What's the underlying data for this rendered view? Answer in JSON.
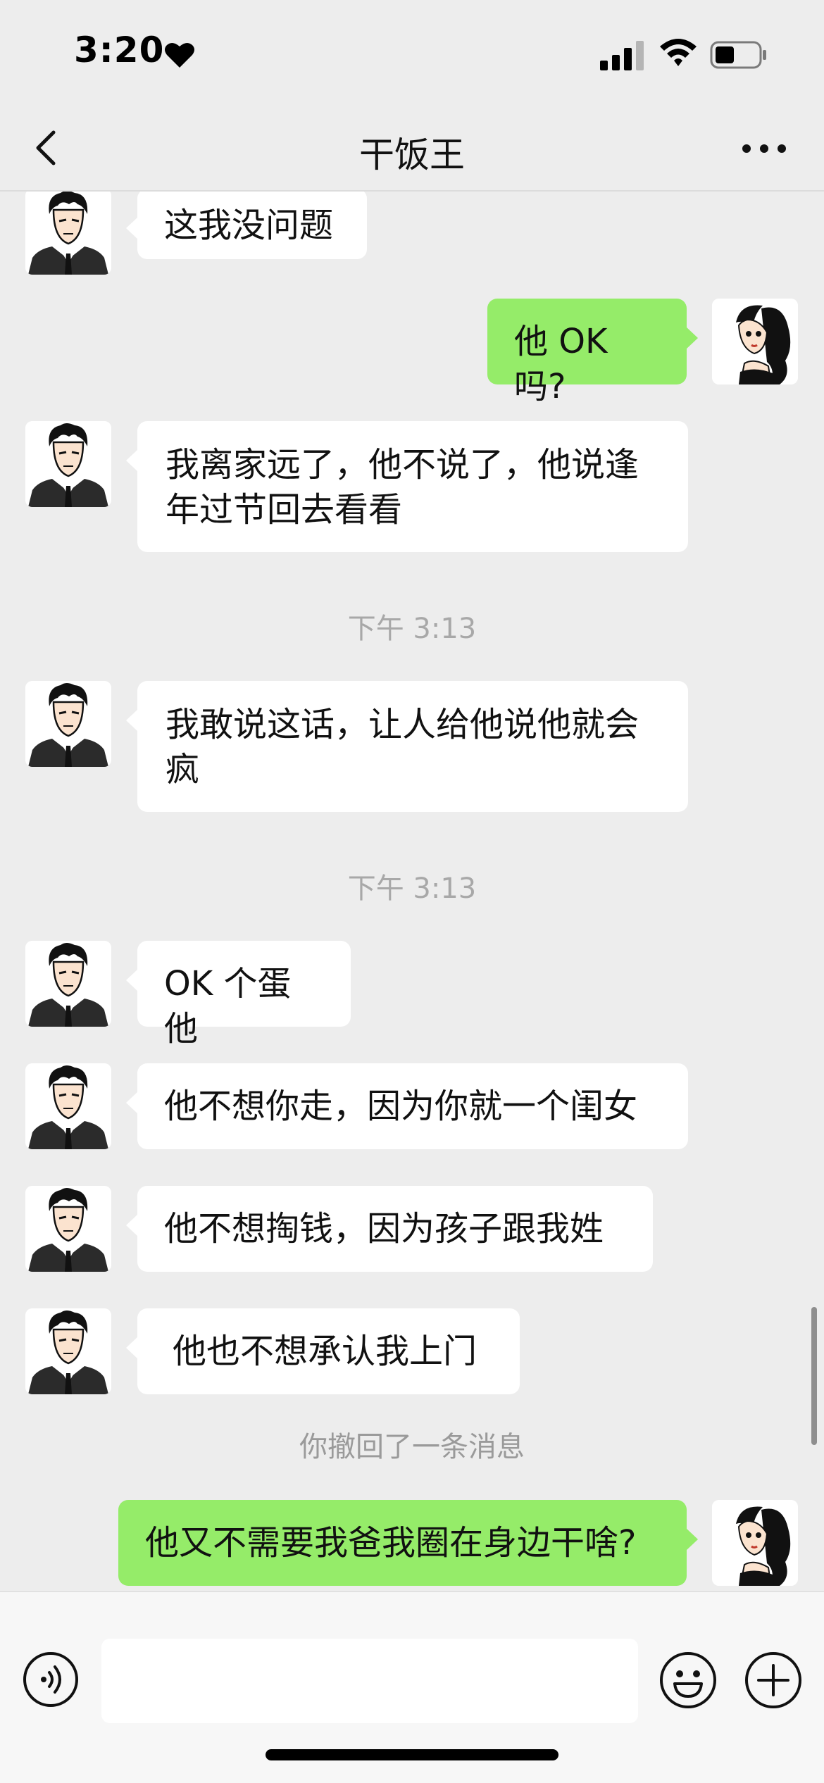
{
  "status": {
    "time": "3:20"
  },
  "header": {
    "title": "干饭王"
  },
  "messages": [
    {
      "text": "这我没问题"
    },
    {
      "text": "他 OK 吗?"
    },
    {
      "text": "我离家远了，他不说了，他说逢年过节回去看看"
    },
    {
      "text": "下午 3:13"
    },
    {
      "text": "我敢说这话，让人给他说他就会疯"
    },
    {
      "text": "下午 3:13"
    },
    {
      "text": "OK 个蛋他"
    },
    {
      "text": "他不想你走，因为你就一个闺女"
    },
    {
      "text": "他不想掏钱，因为孩子跟我姓"
    },
    {
      "text": "他也不想承认我上门"
    },
    {
      "text": "你撤回了一条消息"
    },
    {
      "text": "他又不需要我爸我圈在身边干啥?"
    }
  ],
  "colors": {
    "background": "#ededed",
    "bubble_in": "#ffffff",
    "bubble_out": "#95ec69"
  },
  "icons": [
    "heart-icon",
    "signal-icon",
    "wifi-icon",
    "battery-icon",
    "back-icon",
    "more-icon",
    "voice-icon",
    "emoji-icon",
    "plus-icon"
  ]
}
